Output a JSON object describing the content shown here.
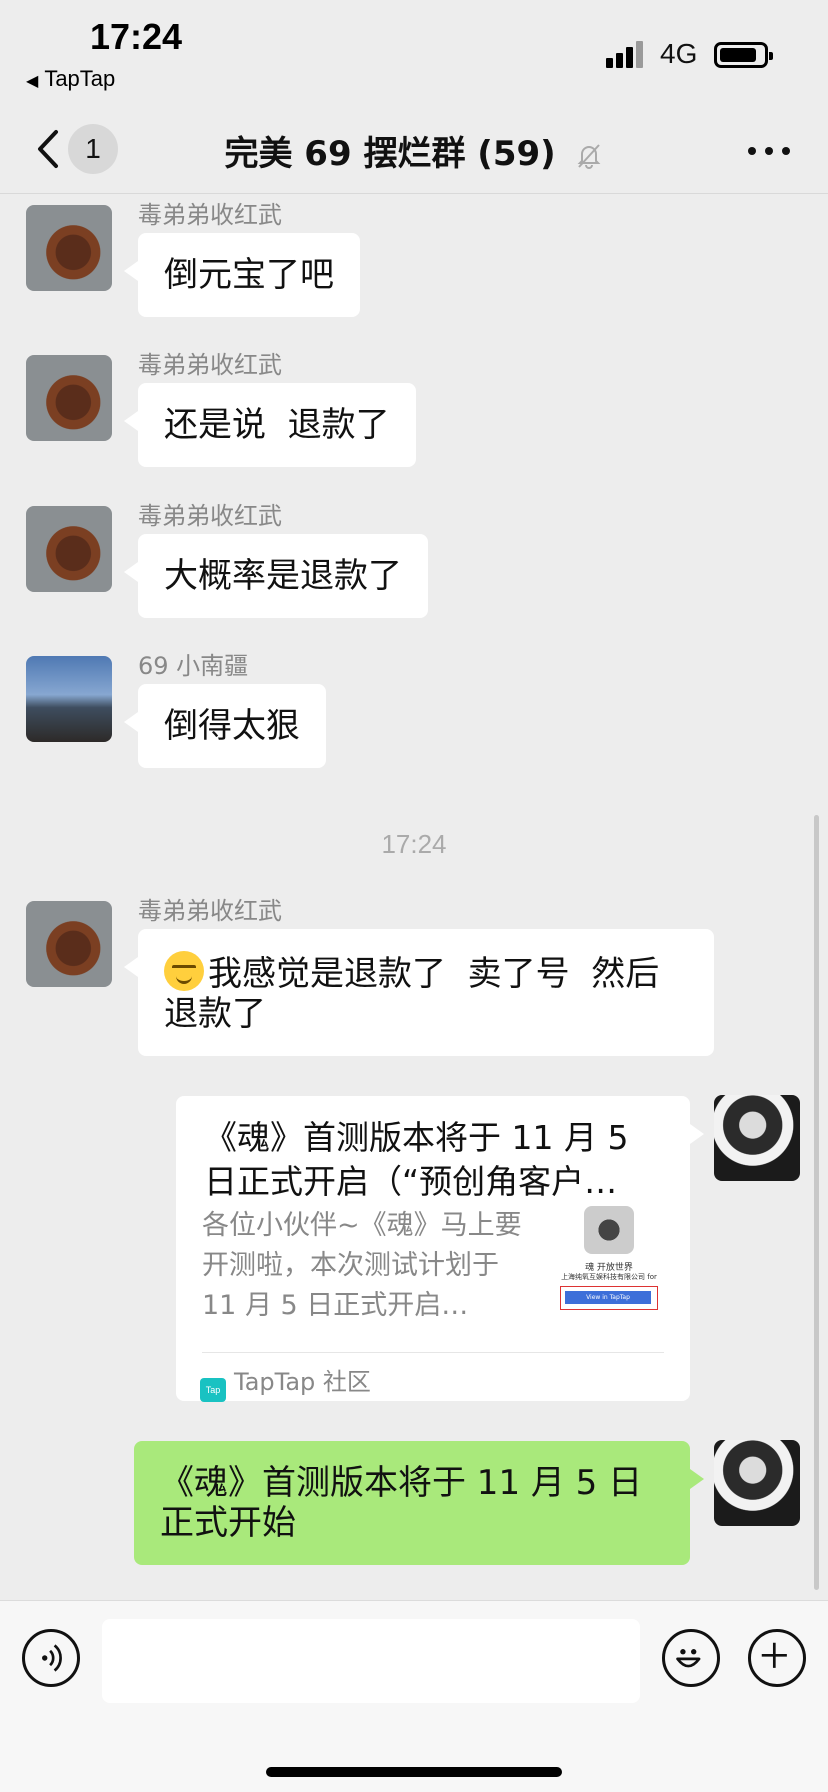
{
  "status_bar": {
    "time": "17:24",
    "back_app": "TapTap",
    "network": "4G"
  },
  "nav": {
    "unread_count": "1",
    "title": "完美 69 摆烂群 (59)",
    "muted": true
  },
  "messages": [
    {
      "sender": "毒弟弟收红武",
      "text": "倒元宝了吧",
      "side": "left"
    },
    {
      "sender": "毒弟弟收红武",
      "text": "还是说  退款了",
      "side": "left"
    },
    {
      "sender": "毒弟弟收红武",
      "text": "大概率是退款了",
      "side": "left"
    },
    {
      "sender": "69 小南疆",
      "text": "倒得太狠",
      "side": "left"
    },
    {
      "timestamp": "17:24"
    },
    {
      "sender": "毒弟弟收红武",
      "text": "我感觉是退款了  卖了号  然后退款了",
      "side": "left",
      "emoji": "smirk-face"
    },
    {
      "side": "right",
      "card": {
        "title": "《魂》首测版本将于 11 月 5 日正式开启（“预创角客户…",
        "description": "各位小伙伴~《魂》马上要开测啦，本次测试计划于 11 月 5 日正式开启…",
        "thumb_line1": "魂 开放世界",
        "thumb_line2": "上海纯氧互娱科技有限公司 for",
        "thumb_button": "View in TapTap",
        "source": "TapTap 社区",
        "source_logo": "Tap"
      }
    },
    {
      "side": "right",
      "text": "《魂》首测版本将于 11 月 5 日正式开始",
      "style": "green"
    }
  ],
  "input_bar": {
    "placeholder": "",
    "icons": [
      "voice-icon",
      "emoji-icon",
      "plus-icon"
    ]
  },
  "colors": {
    "background": "#ededed",
    "bubble_white": "#ffffff",
    "bubble_green": "#a9e97b",
    "meta_gray": "#888888"
  }
}
